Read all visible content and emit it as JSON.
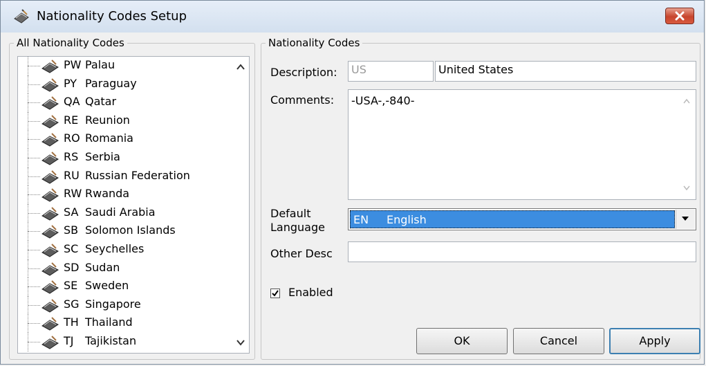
{
  "window": {
    "title": "Nationality Codes Setup",
    "icon": "book-pen-icon"
  },
  "left_panel": {
    "legend": "All Nationality Codes",
    "items": [
      {
        "code": "PW",
        "name": "Palau"
      },
      {
        "code": "PY",
        "name": "Paraguay"
      },
      {
        "code": "QA",
        "name": "Qatar"
      },
      {
        "code": "RE",
        "name": "Reunion"
      },
      {
        "code": "RO",
        "name": "Romania"
      },
      {
        "code": "RS",
        "name": "Serbia"
      },
      {
        "code": "RU",
        "name": "Russian Federation"
      },
      {
        "code": "RW",
        "name": "Rwanda"
      },
      {
        "code": "SA",
        "name": "Saudi Arabia"
      },
      {
        "code": "SB",
        "name": "Solomon Islands"
      },
      {
        "code": "SC",
        "name": "Seychelles"
      },
      {
        "code": "SD",
        "name": "Sudan"
      },
      {
        "code": "SE",
        "name": "Sweden"
      },
      {
        "code": "SG",
        "name": "Singapore"
      },
      {
        "code": "TH",
        "name": "Thailand"
      },
      {
        "code": "TJ",
        "name": "Tajikistan"
      }
    ]
  },
  "right_panel": {
    "legend": "Nationality Codes",
    "description_label": "Description:",
    "code_value": "US",
    "description_value": "United States",
    "comments_label": "Comments:",
    "comments_value": "-USA-,-840-",
    "default_language_label_1": "Default",
    "default_language_label_2": "Language",
    "language_code": "EN",
    "language_name": "English",
    "other_desc_label": "Other Desc",
    "other_desc_value": "",
    "enabled_label": "Enabled",
    "enabled_checked": true
  },
  "buttons": {
    "ok": "OK",
    "cancel": "Cancel",
    "apply": "Apply"
  },
  "colors": {
    "selection": "#3c8de0",
    "close_button": "#c7452d"
  }
}
